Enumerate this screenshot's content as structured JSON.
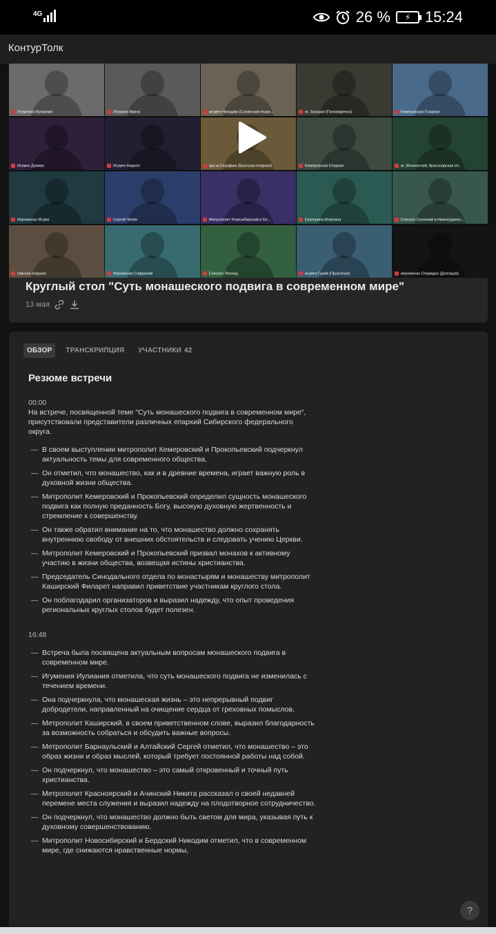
{
  "status_bar": {
    "network": "4G",
    "battery_percent": "26 %",
    "time": "15:24",
    "icons": [
      "signal-icon",
      "eye-icon",
      "alarm-icon",
      "battery-charging-icon"
    ]
  },
  "app": {
    "title": "КонтурТолк"
  },
  "video": {
    "tiles": [
      {
        "name": "Игумения Иулиания",
        "color": "#6b6b6b"
      },
      {
        "name": "Инокиня Ирина",
        "color": "#5a5a5a"
      },
      {
        "name": "игумен Никодим (Салинский епарх...",
        "color": "#6a6355"
      },
      {
        "name": "иг. Захария (Пономаренко)",
        "color": "#3a3a32"
      },
      {
        "name": "Кемеровская Епархия",
        "color": "#4a6a8a"
      },
      {
        "name": "Игумен Даниил",
        "color": "#2e1f3a"
      },
      {
        "name": "Игумен Кирилл",
        "color": "#231f33"
      },
      {
        "name": "арх.м.Серафим (Братская епархия)",
        "color": "#6a5a3a"
      },
      {
        "name": "Кемеровская Епархия",
        "color": "#3c4a42"
      },
      {
        "name": "иг. Иннокентий, Красноярская еп.",
        "color": "#244433"
      },
      {
        "name": "Иеромонах Исаия",
        "color": "#1f3a40"
      },
      {
        "name": "Сергей Чепин",
        "color": "#2b3d6a"
      },
      {
        "name": "Митрополит Новосибирский и Бе...",
        "color": "#3a2f66"
      },
      {
        "name": "Екатерина Игоревна",
        "color": "#2a5a52"
      },
      {
        "name": "Епископ Саянский и Нижнеудинск...",
        "color": "#38574d"
      },
      {
        "name": "Омская епархия",
        "color": "#5b4e40"
      },
      {
        "name": "Иеромонах Софроний",
        "color": "#376b70"
      },
      {
        "name": "Епископ Леонид",
        "color": "#33603f"
      },
      {
        "name": "игумен Гурий (Прокопчук)",
        "color": "#3a5e72"
      },
      {
        "name": "иеромонах Спиридон (Долгацов)",
        "color": "#141414"
      }
    ],
    "title": "Круглый стол \"Суть монашеского подвига в современном мире\"",
    "date": "13 мая"
  },
  "tabs": [
    {
      "label": "ОБЗОР",
      "active": true,
      "count": ""
    },
    {
      "label": "ТРАНСКРИПЦИЯ",
      "active": false,
      "count": ""
    },
    {
      "label": "УЧАСТНИКИ",
      "active": false,
      "count": "42"
    }
  ],
  "summary": {
    "title": "Резюме встречи",
    "section1": {
      "time": "00:00",
      "intro": "На встрече, посвященной теме \"Суть монашеского подвига в современном мире\", присутствовали представители различных епархий Сибирского федерального округа.",
      "bullets": [
        "В своем выступлении митрополит Кемеровский и Прокопьевский подчеркнул актуальность темы для современного общества.",
        "Он отметил, что монашество, как и в древние времена, играет важную роль в духовной жизни общества.",
        "Митрополит Кемеровский и Прокопьевский определил сущность монашеского подвига как полную преданность Богу, высокую духовную жертвенность и стремление к совершенству.",
        "Он также обратил внимание на то, что монашество должно сохранять внутреннюю свободу от внешних обстоятельств и следовать учению Церкви.",
        "Митрополит Кемеровский и Прокопьевский призвал монахов к активному участию в жизни общества, возвещая истины христианства.",
        "Председатель Синодального отдела по монастырям и монашеству митрополит Каширский Филарет направил приветствие участникам круглого стола.",
        "Он поблагодарил организаторов и выразил надежду, что опыт проведения региональных круглых столов будет полезен."
      ]
    },
    "section2": {
      "time": "16:48",
      "bullets": [
        "Встреча была посвящена актуальным вопросам монашеского подвига в современном мире.",
        "Игумения Иулиания отметила, что суть монашеского подвига не изменилась с течением времени.",
        "Она подчеркнула, что монашеская жизнь – это непрерывный подвиг добродетели, направленный на очищение сердца от греховных помыслов.",
        "Метрополит Каширский, в своем приветственном слове, выразил благодарность за возможность собраться и обсудить важные вопросы.",
        "Метрополит Барнаульский и Алтайский Сергей отметил, что монашество – это образ жизни и образ мыслей, который требует постоянной работы над собой.",
        "Он подчеркнул, что монашество – это самый откровенный и точный путь христианства.",
        "Метрополит Красноярский и Ачинский Никита рассказал о своей недавней перемене места служения и выразил надежду на плодотворное сотрудничество.",
        "Он подчеркнул, что монашество должно быть светом для мира, указывая путь к духовному совершенствованию.",
        "Митрополит Новосибирский и Бердский Никодим отметил, что в современном мире, где снижаются нравственные нормы,"
      ]
    }
  },
  "help": {
    "label": "?"
  }
}
